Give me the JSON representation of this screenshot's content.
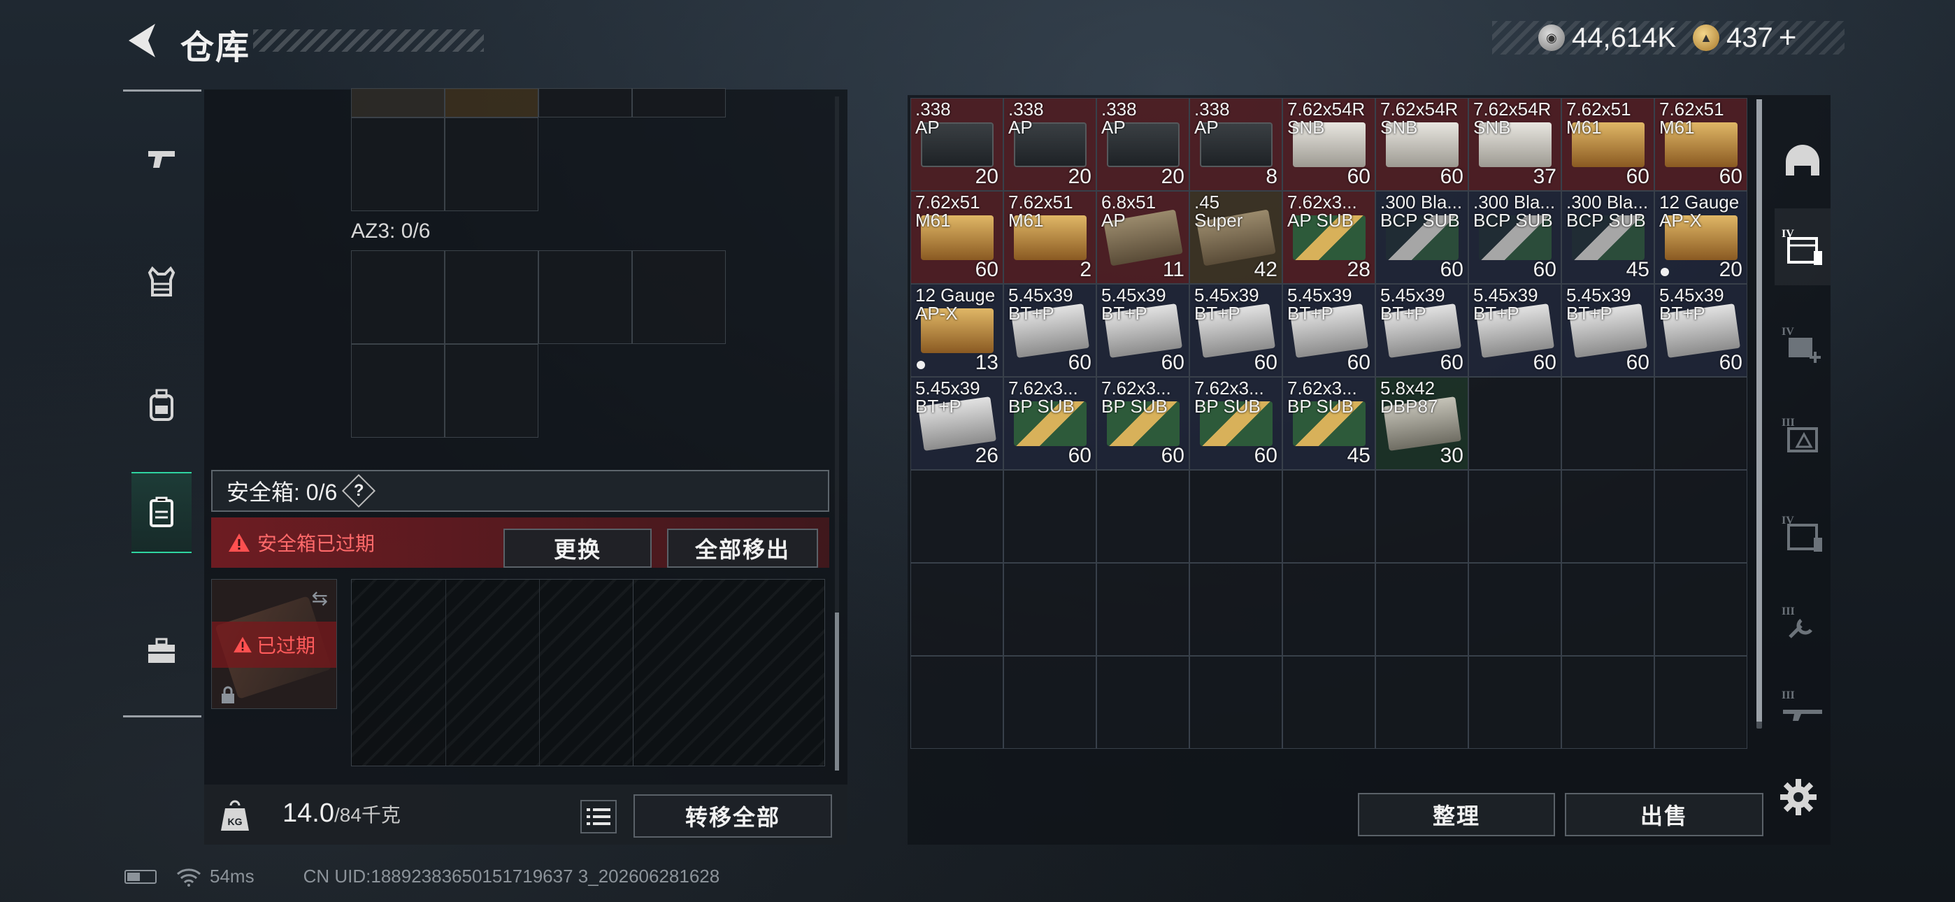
{
  "header": {
    "title": "仓库",
    "currency": [
      {
        "icon": "silver-coin-icon",
        "value": "44,614K"
      },
      {
        "icon": "gold-coin-icon",
        "value": "437"
      }
    ],
    "plus": "+"
  },
  "left_nav": [
    {
      "name": "weapons",
      "icon": "pistol-icon",
      "active": false
    },
    {
      "name": "armor",
      "icon": "vest-icon",
      "active": false
    },
    {
      "name": "backpack",
      "icon": "backpack-icon",
      "active": false
    },
    {
      "name": "safe-case",
      "icon": "case-icon",
      "active": true
    },
    {
      "name": "toolbox",
      "icon": "toolbox-icon",
      "active": false
    }
  ],
  "left_panel": {
    "az3_label": "AZ3: 0/6",
    "safe_box_title": "安全箱: 0/6",
    "help": "?",
    "expired_warning": "安全箱已过期",
    "replace_button": "更换",
    "move_all_out_button": "全部移出",
    "case_expired": "已过期",
    "weight_value": "14.0",
    "weight_max": "/84千克",
    "weight_icon": "KG",
    "transfer_all_button": "转移全部"
  },
  "inventory": [
    {
      "name": ".338\nAP",
      "count": "20",
      "bg": "red",
      "art": "box-dark"
    },
    {
      "name": ".338\nAP",
      "count": "20",
      "bg": "red",
      "art": "box-dark"
    },
    {
      "name": ".338\nAP",
      "count": "20",
      "bg": "red",
      "art": "box-dark"
    },
    {
      "name": ".338\nAP",
      "count": "8",
      "bg": "red",
      "art": "box-dark"
    },
    {
      "name": "7.62x54R\nSNB",
      "count": "60",
      "bg": "red",
      "art": "box-white"
    },
    {
      "name": "7.62x54R\nSNB",
      "count": "60",
      "bg": "red",
      "art": "box-white"
    },
    {
      "name": "7.62x54R\nSNB",
      "count": "37",
      "bg": "red",
      "art": "box-white"
    },
    {
      "name": "7.62x51\nM61",
      "count": "60",
      "bg": "red",
      "art": "box-gold"
    },
    {
      "name": "7.62x51\nM61",
      "count": "60",
      "bg": "red",
      "art": "box-gold"
    },
    {
      "name": "7.62x51\nM61",
      "count": "60",
      "bg": "red",
      "art": "box-gold"
    },
    {
      "name": "7.62x51\nM61",
      "count": "2",
      "bg": "red",
      "art": "box-gold"
    },
    {
      "name": "6.8x51\nAP",
      "count": "11",
      "bg": "red",
      "art": "box-tan"
    },
    {
      "name": ".45\nSuper",
      "count": "42",
      "bg": "gold",
      "art": "box-tan"
    },
    {
      "name": "7.62x3...\nAP SUB",
      "count": "28",
      "bg": "red",
      "art": "bullets"
    },
    {
      "name": ".300 Bla...\nBCP SUB",
      "count": "60",
      "bg": "blue",
      "art": "bullets-d"
    },
    {
      "name": ".300 Bla...\nBCP SUB",
      "count": "60",
      "bg": "blue",
      "art": "bullets-d"
    },
    {
      "name": ".300 Bla...\nBCP SUB",
      "count": "45",
      "bg": "blue",
      "art": "bullets-d"
    },
    {
      "name": "12 Gauge\nAP-X",
      "count": "20",
      "bg": "blue",
      "art": "box-gold",
      "dot": true
    },
    {
      "name": "12 Gauge\nAP-X",
      "count": "13",
      "bg": "blue",
      "art": "box-gold",
      "dot": true
    },
    {
      "name": "5.45x39\nBT+P",
      "count": "60",
      "bg": "blue",
      "art": "box-grey"
    },
    {
      "name": "5.45x39\nBT+P",
      "count": "60",
      "bg": "blue",
      "art": "box-grey"
    },
    {
      "name": "5.45x39\nBT+P",
      "count": "60",
      "bg": "blue",
      "art": "box-grey"
    },
    {
      "name": "5.45x39\nBT+P",
      "count": "60",
      "bg": "blue",
      "art": "box-grey"
    },
    {
      "name": "5.45x39\nBT+P",
      "count": "60",
      "bg": "blue",
      "art": "box-grey"
    },
    {
      "name": "5.45x39\nBT+P",
      "count": "60",
      "bg": "blue",
      "art": "box-grey"
    },
    {
      "name": "5.45x39\nBT+P",
      "count": "60",
      "bg": "blue",
      "art": "box-grey"
    },
    {
      "name": "5.45x39\nBT+P",
      "count": "60",
      "bg": "blue",
      "art": "box-grey"
    },
    {
      "name": "5.45x39\nBT+P",
      "count": "26",
      "bg": "blue",
      "art": "box-grey"
    },
    {
      "name": "7.62x3...\nBP SUB",
      "count": "60",
      "bg": "blue",
      "art": "bullets"
    },
    {
      "name": "7.62x3...\nBP SUB",
      "count": "60",
      "bg": "blue",
      "art": "bullets"
    },
    {
      "name": "7.62x3...\nBP SUB",
      "count": "60",
      "bg": "blue",
      "art": "bullets"
    },
    {
      "name": "7.62x3...\nBP SUB",
      "count": "45",
      "bg": "blue",
      "art": "bullets"
    },
    {
      "name": "5.8x42\nDBP87",
      "count": "30",
      "bg": "green",
      "art": "box-green"
    }
  ],
  "bottom_buttons": {
    "sort": "整理",
    "sell": "出售"
  },
  "right_nav": [
    {
      "name": "helmet",
      "icon": "helmet-icon",
      "tier": "",
      "active": false
    },
    {
      "name": "storage-iv",
      "icon": "storage-icon",
      "tier": "IV",
      "active": true
    },
    {
      "name": "medical-iv",
      "icon": "medkit-icon",
      "tier": "IV",
      "active": false
    },
    {
      "name": "throwables-iii",
      "icon": "grenade-icon",
      "tier": "III",
      "active": false
    },
    {
      "name": "storage-iv-2",
      "icon": "storage-icon",
      "tier": "IV",
      "active": false
    },
    {
      "name": "tools-iii",
      "icon": "tools-icon",
      "tier": "III",
      "active": false
    },
    {
      "name": "weapons-iii",
      "icon": "rifle-icon",
      "tier": "III",
      "active": false
    }
  ],
  "status_bar": {
    "ping": "54ms",
    "uid": "CN UID:18892383650151719637 3_202606281628"
  }
}
